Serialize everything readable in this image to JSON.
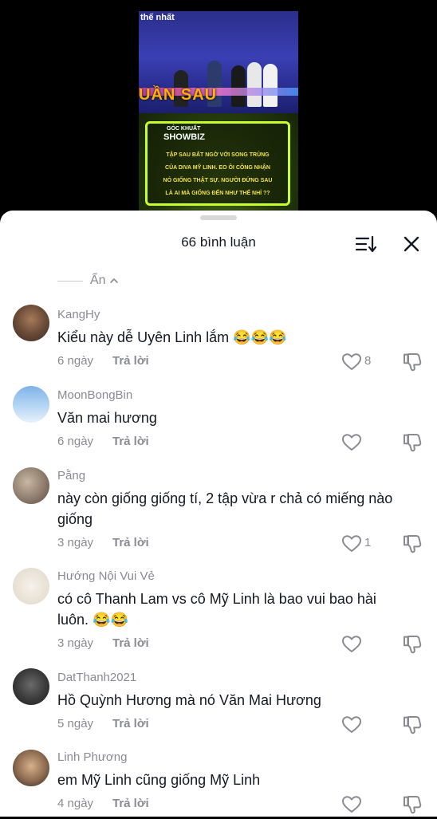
{
  "video": {
    "top_caption": "thế nhất",
    "big_caption": "UẦN SAU",
    "overlay_small": "GÓC KHUẤT",
    "overlay_big": "SHOWBIZ",
    "overlay_lines": [
      "TẬP SAU BẤT NGỜ VỚI SONG TRÙNG",
      "CỦA DIVA MỸ LINH. EO ÔI CÔNG NHẬN",
      "NÓ GIỐNG THẬT SỰ. NGƯỜI ĐỨNG SAU",
      "LÀ AI MÀ GIỐNG ĐẾN NHƯ THẾ NHỈ ??"
    ]
  },
  "header": {
    "title": "66 bình luận",
    "sort_icon": "sort-icon",
    "close_icon": "close-icon"
  },
  "hide": {
    "label": "Ẩn"
  },
  "comments": [
    {
      "username": "KangHy",
      "text": "Kiểu này dễ Uyên Linh lắm 😂😂😂",
      "date": "6 ngày",
      "reply": "Trả lời",
      "likes": "8"
    },
    {
      "username": "MoonBongBin",
      "text": "Văn mai hương",
      "date": "6 ngày",
      "reply": "Trả lời",
      "likes": ""
    },
    {
      "username": "Pằng",
      "text": "này còn giống giống tí, 2 tập vừa r chả có miếng nào giống",
      "date": "3 ngày",
      "reply": "Trả lời",
      "likes": "1"
    },
    {
      "username": "Hướng Nội Vui Vẻ",
      "text": "có cô Thanh Lam vs cô Mỹ Linh là bao vui bao hài luôn. 😂😂",
      "date": "3 ngày",
      "reply": "Trả lời",
      "likes": ""
    },
    {
      "username": "DatThanh2021",
      "text": "Hồ Quỳnh Hương mà nó Văn Mai Hương",
      "date": "5 ngày",
      "reply": "Trả lời",
      "likes": ""
    },
    {
      "username": "Linh Phương",
      "text": "em Mỹ Linh cũng giống Mỹ Linh",
      "date": "4 ngày",
      "reply": "Trả lời",
      "likes": ""
    }
  ]
}
